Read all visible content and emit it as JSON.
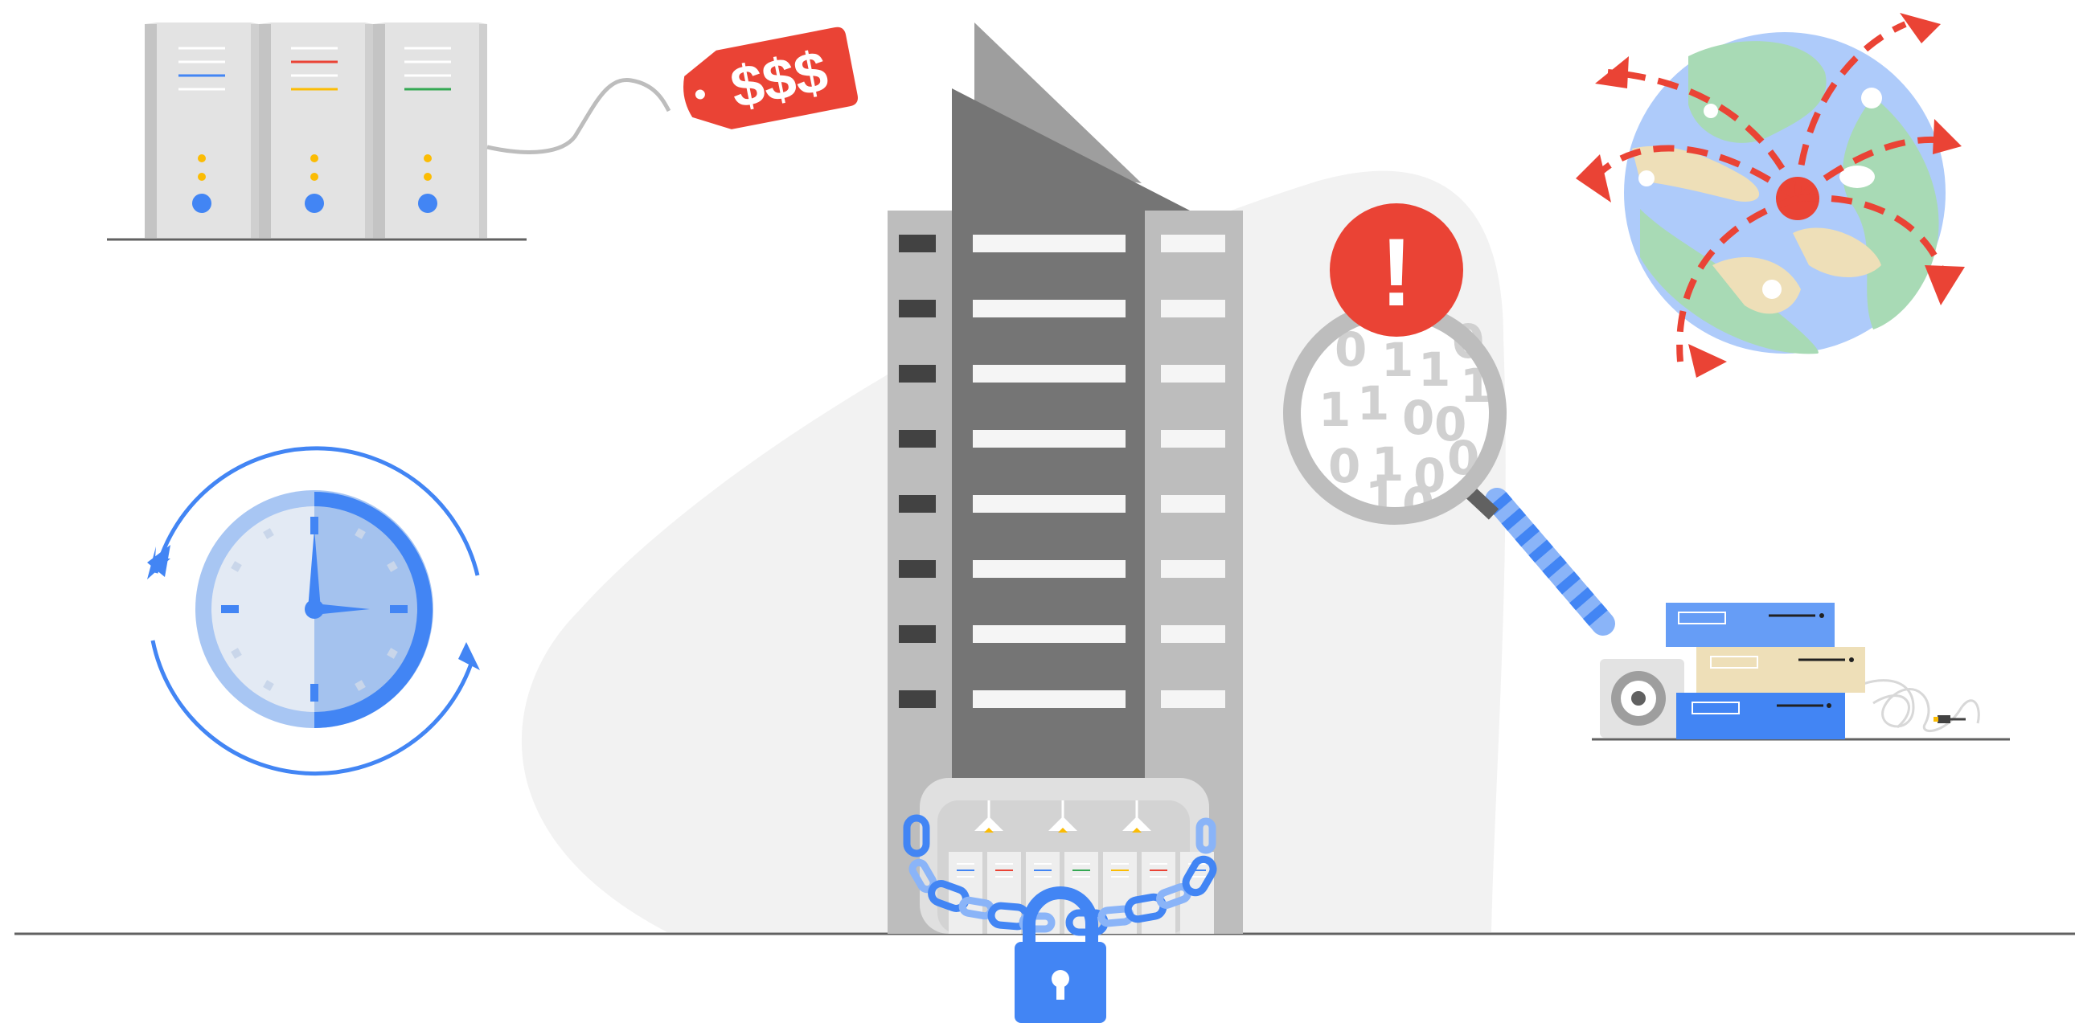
{
  "price_tag": {
    "text": "$$$"
  },
  "alert": {
    "symbol": "!"
  },
  "binary_digits": [
    "0",
    "1",
    "1",
    "0",
    "1",
    "1",
    "0",
    "0",
    "1",
    "0",
    "1",
    "0",
    "0",
    "1",
    "0"
  ],
  "colors": {
    "blue": "#4285f4",
    "light_blue": "#a8c6f3",
    "red": "#ea4335",
    "yellow": "#fbbc04",
    "green": "#34a853",
    "gray_dark": "#757575",
    "gray_mid": "#bdbdbd",
    "gray_light": "#e0e0e0",
    "backdrop": "#f2f2f2",
    "tan": "#eedfb8",
    "land_green": "#a8dab5"
  },
  "icons": [
    "server-rack-icon",
    "price-tag-icon",
    "office-building-icon",
    "chain-icon",
    "padlock-icon",
    "clock-icon",
    "refresh-arrows-icon",
    "magnifying-glass-icon",
    "alert-icon",
    "globe-icon",
    "stacked-hardware-icon"
  ]
}
